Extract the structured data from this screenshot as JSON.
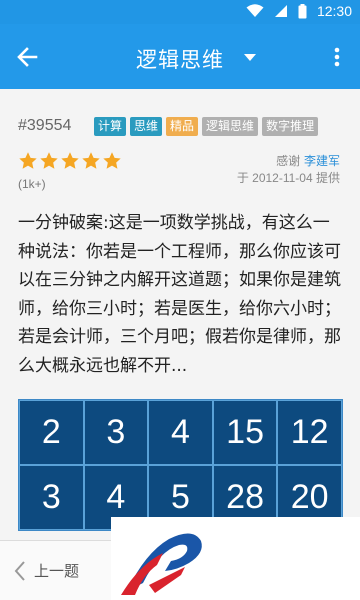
{
  "status_bar": {
    "time": "12:30"
  },
  "app_bar": {
    "title": "逻辑思维"
  },
  "puzzle": {
    "id": "#39554",
    "tags": [
      {
        "label": "计算",
        "color": "#2a9bbf"
      },
      {
        "label": "思维",
        "color": "#2a9bbf"
      },
      {
        "label": "精品",
        "color": "#f0ad4e"
      },
      {
        "label": "逻辑思维",
        "color": "#b0b0b0"
      },
      {
        "label": "数字推理",
        "color": "#b0b0b0"
      }
    ],
    "rating": {
      "stars": 5,
      "max": 5,
      "count_label": "(1k+)"
    },
    "thanks_prefix": "感谢",
    "author": "李建军",
    "provided": "于 2012-11-04 提供",
    "text": "一分钟破案:这是一项数学挑战，有这么一种说法：你若是一个工程师，那么你应该可以在三分钟之内解开这道题；如果你是建筑师，给你三小时；若是医生，给你六小时；若是会计师，三个月吧；假若你是律师，那么大概永远也解不开...",
    "grid": {
      "rows": [
        [
          "2",
          "3",
          "4",
          "15",
          "12"
        ],
        [
          "3",
          "4",
          "5",
          "28",
          "20"
        ]
      ]
    }
  },
  "bottom_bar": {
    "prev_label": "上一题"
  },
  "colors": {
    "primary": "#2399e9",
    "star": "#f5a623",
    "grid_bg": "#0d4a7f"
  }
}
